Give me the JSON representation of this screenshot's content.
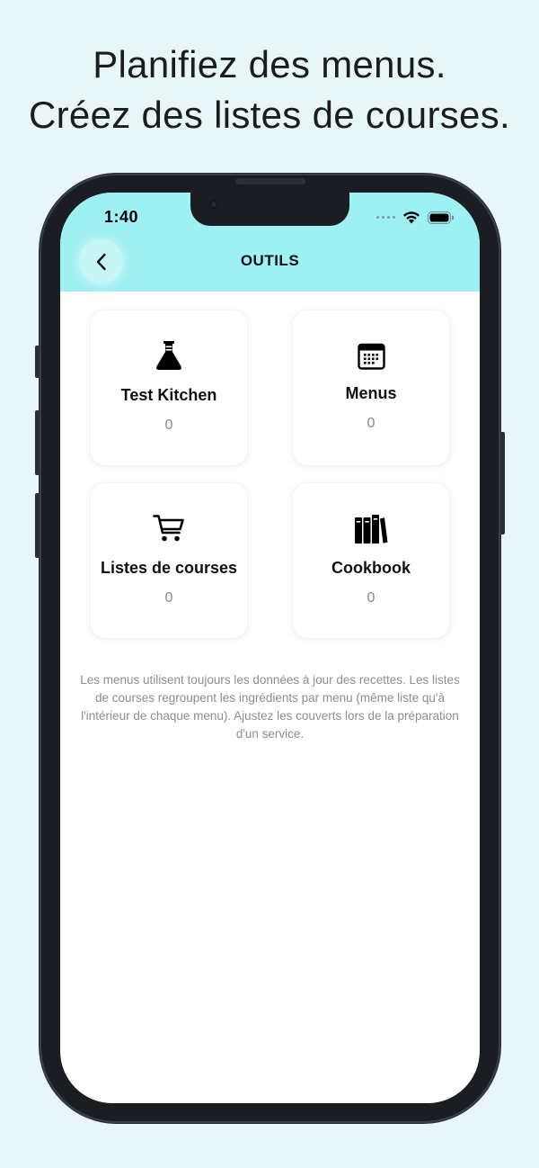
{
  "headline": {
    "line1": "Planifiez des menus.",
    "line2": "Créez des listes de courses."
  },
  "status_bar": {
    "time": "1:40",
    "icons": [
      "signal-dots-icon",
      "wifi-icon",
      "battery-icon"
    ]
  },
  "header": {
    "title": "OUTILS",
    "back_icon": "chevron-left-icon",
    "background": "#9ff0f2"
  },
  "cards": [
    {
      "label": "Test Kitchen",
      "count": "0",
      "icon": "flask-icon"
    },
    {
      "label": "Menus",
      "count": "0",
      "icon": "calendar-icon"
    },
    {
      "label": "Listes de courses",
      "count": "0",
      "icon": "cart-icon"
    },
    {
      "label": "Cookbook",
      "count": "0",
      "icon": "books-icon"
    }
  ],
  "note": "Les menus utilisent toujours les données à jour des recettes. Les listes de courses regroupent les ingrédients par menu (même liste qu'à l'intérieur de chaque menu). Ajustez les couverts lors de la préparation d'un service."
}
